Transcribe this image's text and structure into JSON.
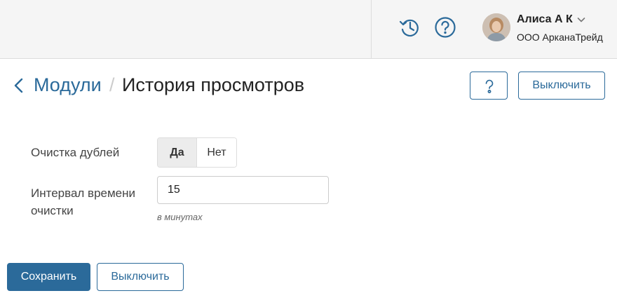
{
  "topbar": {
    "history_icon": "history-icon",
    "help_icon": "help-icon",
    "user": {
      "name": "Алиса А К",
      "company": "ООО АрканаТрейд",
      "avatar_icon": "avatar-photo"
    }
  },
  "header": {
    "back_icon": "chevron-left-icon",
    "breadcrumb_parent": "Модули",
    "breadcrumb_separator": "/",
    "title": "История просмотров",
    "help_button_icon": "question-icon",
    "disable_label": "Выключить"
  },
  "form": {
    "dedupe": {
      "label": "Очистка дублей",
      "options": [
        "Да",
        "Нет"
      ],
      "selected": "Да"
    },
    "interval": {
      "label": "Интервал времени очистки",
      "value": "15",
      "hint": "в минутах"
    }
  },
  "footer": {
    "save_label": "Сохранить",
    "disable_label": "Выключить"
  },
  "colors": {
    "accent": "#2b6a9a",
    "topbar_bg": "#f5f5f5",
    "toggle_selected_bg": "#ececec"
  }
}
